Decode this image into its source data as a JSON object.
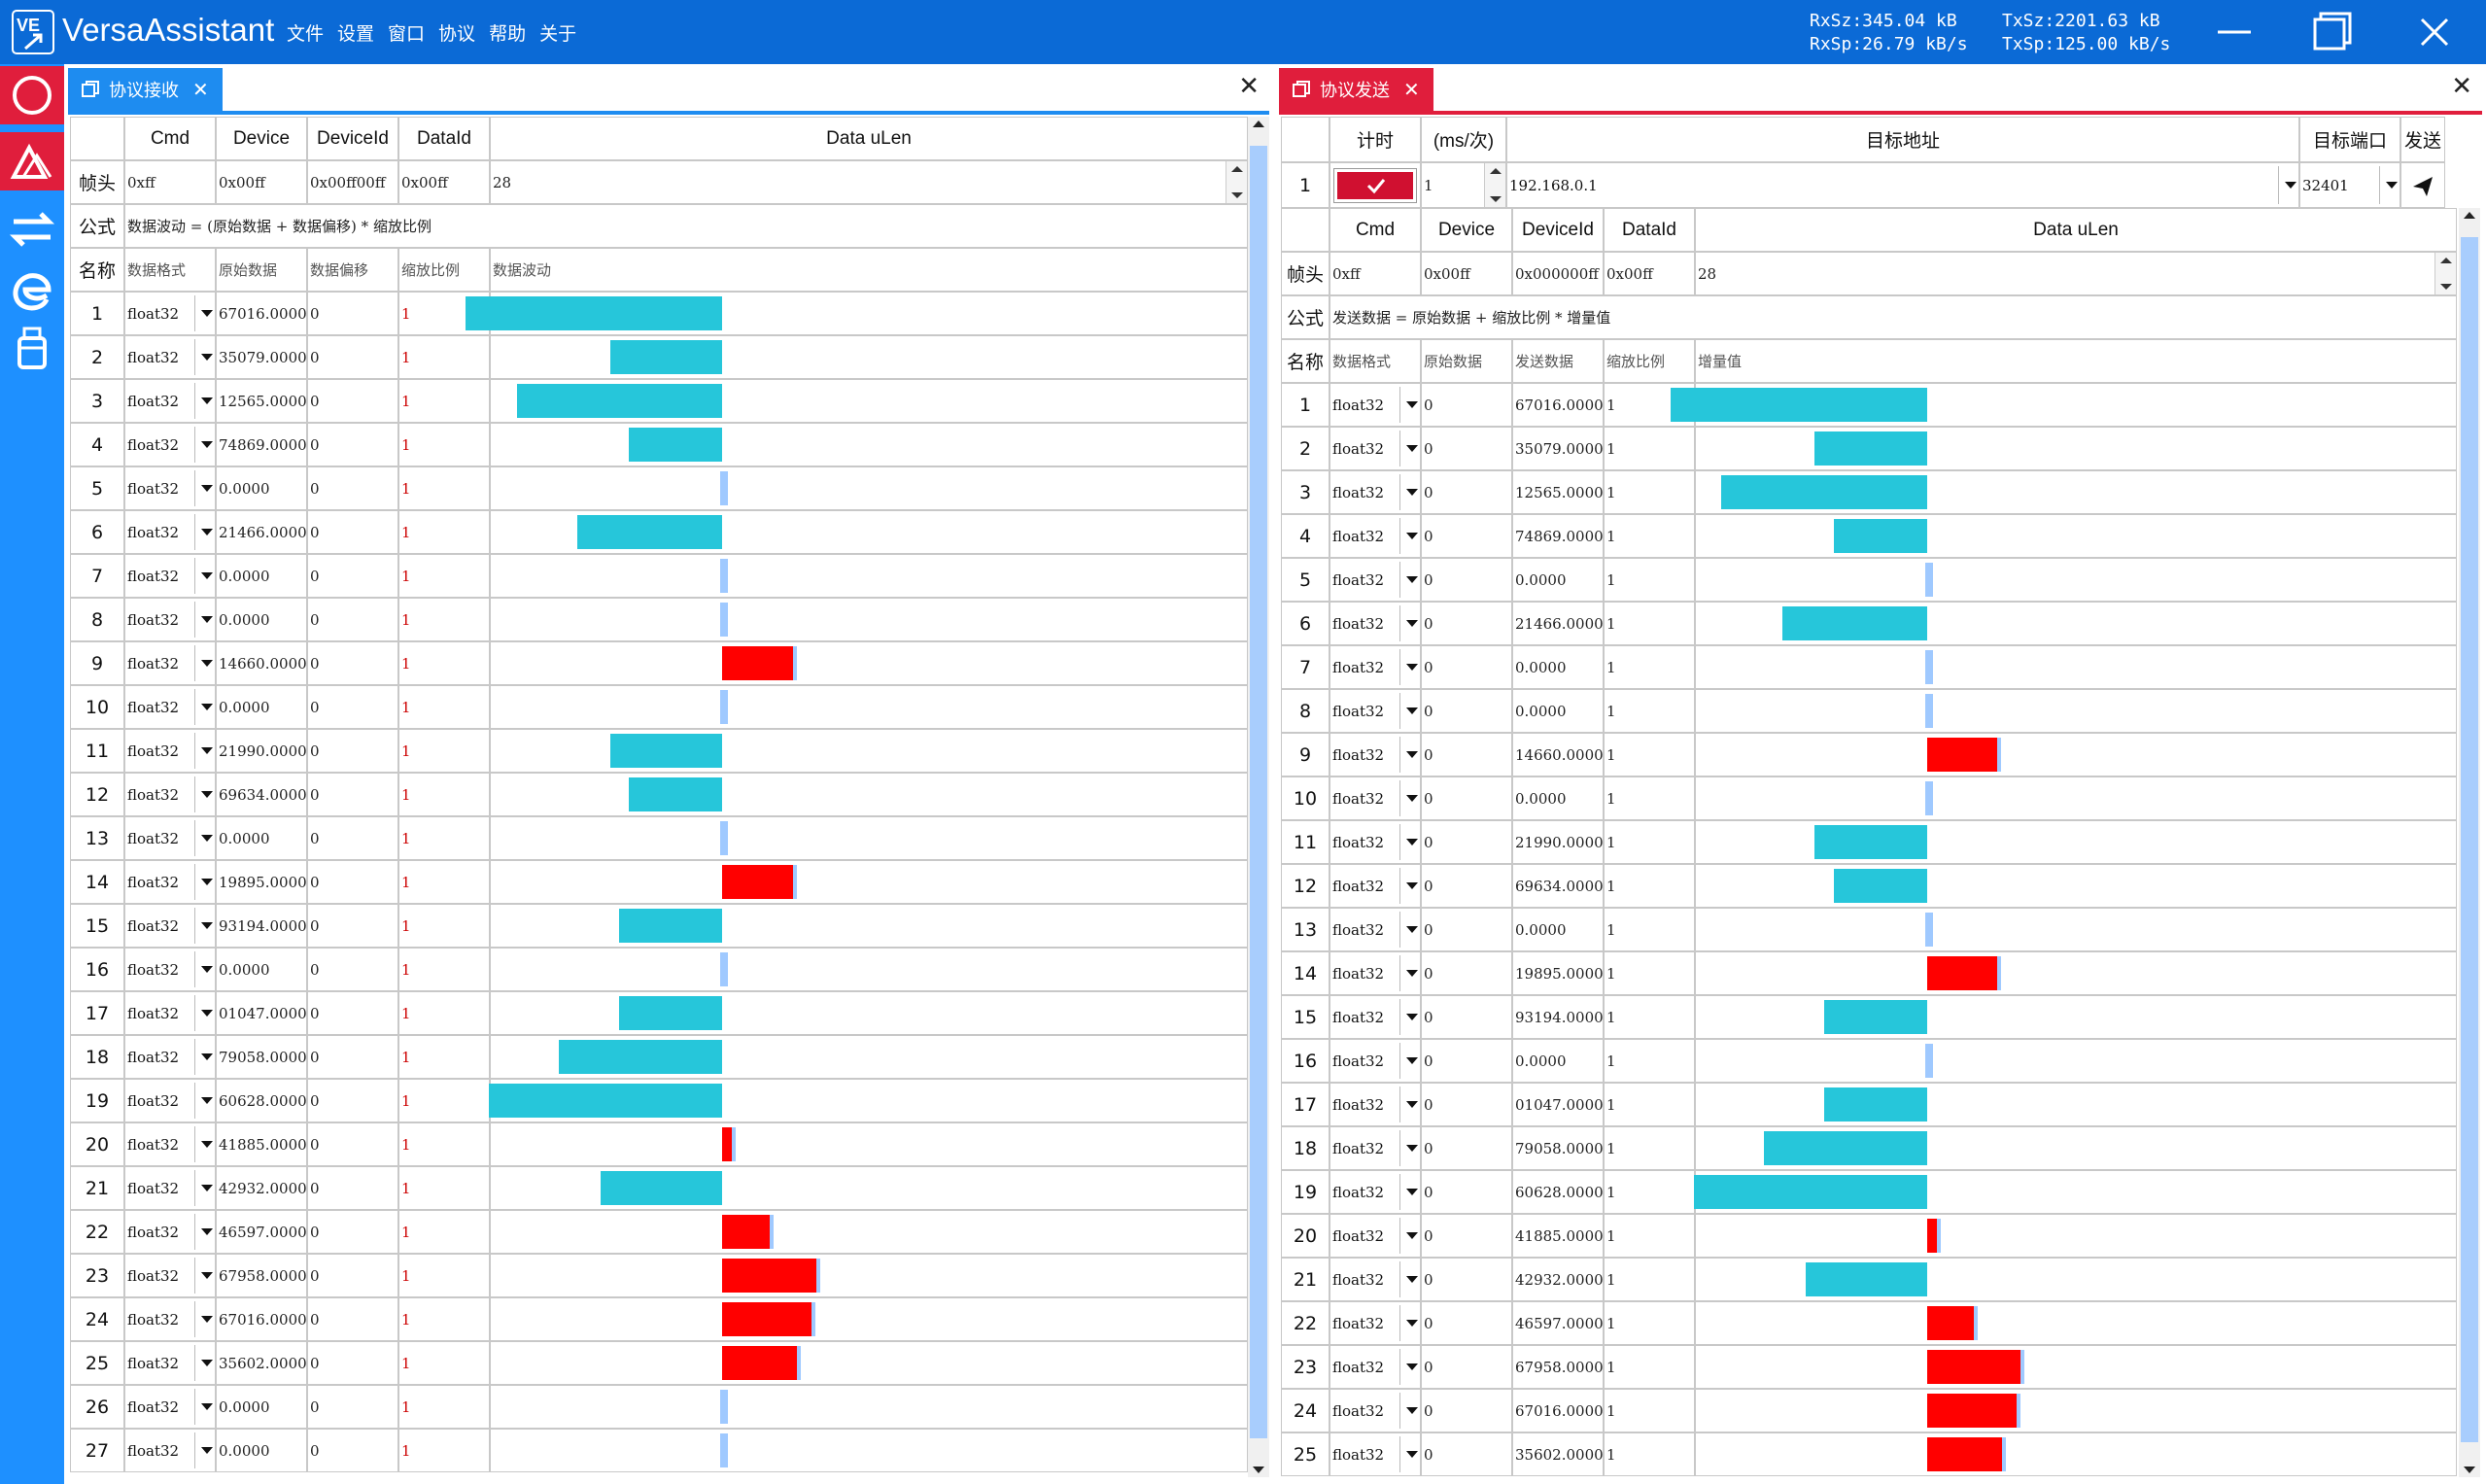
{
  "app": {
    "title": "VersaAssistant",
    "logo_text": "VE",
    "menu": [
      "文件",
      "设置",
      "窗口",
      "协议",
      "帮助",
      "关于"
    ],
    "stats": {
      "rx_size": "RxSz:345.04 kB",
      "tx_size": "TxSz:2201.63 kB",
      "rx_speed": "RxSp:26.79 kB/s",
      "tx_speed": "TxSp:125.00 kB/s"
    },
    "icons": {
      "minimize": "minimize-icon",
      "maximize": "maximize-icon",
      "close": "close-icon"
    }
  },
  "sidebar": {
    "items": [
      {
        "icon": "circle-icon",
        "active": true
      },
      {
        "icon": "triangle-wave-icon",
        "active": false
      },
      {
        "icon": "swap-arrows-icon",
        "active": false
      },
      {
        "icon": "edge-icon",
        "active": false
      },
      {
        "icon": "usb-drive-icon",
        "active": false
      }
    ]
  },
  "colors": {
    "titlebar": "#0b6ad6",
    "sidebar": "#1e90ff",
    "receive_tab": "#1e8cf0",
    "send_tab": "#e01e3c",
    "positive_bar": "#ff0000",
    "negative_bar": "#26c6da",
    "zero_bar": "#9fc9ff"
  },
  "receive": {
    "tab_label": "协议接收",
    "headers": {
      "cmd": "Cmd",
      "device": "Device",
      "deviceid": "DeviceId",
      "dataid": "DataId",
      "ulen": "Data uLen"
    },
    "frame_label": "帧头",
    "frame": {
      "cmd": "0xff",
      "device": "0x00ff",
      "deviceid": "0x00ff00ff",
      "dataid": "0x00ff",
      "ulen": "28"
    },
    "formula_label": "公式",
    "formula": "数据波动 = (原始数据 + 数据偏移) * 缩放比例",
    "name_label": "名称",
    "columns": [
      "数据格式",
      "原始数据",
      "数据偏移",
      "缩放比例",
      "数据波动"
    ],
    "rows": [
      {
        "idx": "1",
        "fmt": "float32",
        "raw": "67016.0000",
        "off": "0",
        "scale": "1",
        "wave": -0.55
      },
      {
        "idx": "2",
        "fmt": "float32",
        "raw": "35079.0000",
        "off": "0",
        "scale": "1",
        "wave": -0.24
      },
      {
        "idx": "3",
        "fmt": "float32",
        "raw": "12565.0000",
        "off": "0",
        "scale": "1",
        "wave": -0.44
      },
      {
        "idx": "4",
        "fmt": "float32",
        "raw": "74869.0000",
        "off": "0",
        "scale": "1",
        "wave": -0.2
      },
      {
        "idx": "5",
        "fmt": "float32",
        "raw": "0.0000",
        "off": "0",
        "scale": "1",
        "wave": 0
      },
      {
        "idx": "6",
        "fmt": "float32",
        "raw": "21466.0000",
        "off": "0",
        "scale": "1",
        "wave": -0.31
      },
      {
        "idx": "7",
        "fmt": "float32",
        "raw": "0.0000",
        "off": "0",
        "scale": "1",
        "wave": 0
      },
      {
        "idx": "8",
        "fmt": "float32",
        "raw": "0.0000",
        "off": "0",
        "scale": "1",
        "wave": 0
      },
      {
        "idx": "9",
        "fmt": "float32",
        "raw": "14660.0000",
        "off": "0",
        "scale": "1",
        "wave": 0.16
      },
      {
        "idx": "10",
        "fmt": "float32",
        "raw": "0.0000",
        "off": "0",
        "scale": "1",
        "wave": 0
      },
      {
        "idx": "11",
        "fmt": "float32",
        "raw": "21990.0000",
        "off": "0",
        "scale": "1",
        "wave": -0.24
      },
      {
        "idx": "12",
        "fmt": "float32",
        "raw": "69634.0000",
        "off": "0",
        "scale": "1",
        "wave": -0.2
      },
      {
        "idx": "13",
        "fmt": "float32",
        "raw": "0.0000",
        "off": "0",
        "scale": "1",
        "wave": 0
      },
      {
        "idx": "14",
        "fmt": "float32",
        "raw": "19895.0000",
        "off": "0",
        "scale": "1",
        "wave": 0.16
      },
      {
        "idx": "15",
        "fmt": "float32",
        "raw": "93194.0000",
        "off": "0",
        "scale": "1",
        "wave": -0.22
      },
      {
        "idx": "16",
        "fmt": "float32",
        "raw": "0.0000",
        "off": "0",
        "scale": "1",
        "wave": 0
      },
      {
        "idx": "17",
        "fmt": "float32",
        "raw": "01047.0000",
        "off": "0",
        "scale": "1",
        "wave": -0.22
      },
      {
        "idx": "18",
        "fmt": "float32",
        "raw": "79058.0000",
        "off": "0",
        "scale": "1",
        "wave": -0.35
      },
      {
        "idx": "19",
        "fmt": "float32",
        "raw": "60628.0000",
        "off": "0",
        "scale": "1",
        "wave": -0.5
      },
      {
        "idx": "20",
        "fmt": "float32",
        "raw": "41885.0000",
        "off": "0",
        "scale": "1",
        "wave": 0.03
      },
      {
        "idx": "21",
        "fmt": "float32",
        "raw": "42932.0000",
        "off": "0",
        "scale": "1",
        "wave": -0.26
      },
      {
        "idx": "22",
        "fmt": "float32",
        "raw": "46597.0000",
        "off": "0",
        "scale": "1",
        "wave": 0.11
      },
      {
        "idx": "23",
        "fmt": "float32",
        "raw": "67958.0000",
        "off": "0",
        "scale": "1",
        "wave": 0.21
      },
      {
        "idx": "24",
        "fmt": "float32",
        "raw": "67016.0000",
        "off": "0",
        "scale": "1",
        "wave": 0.2
      },
      {
        "idx": "25",
        "fmt": "float32",
        "raw": "35602.0000",
        "off": "0",
        "scale": "1",
        "wave": 0.17
      },
      {
        "idx": "26",
        "fmt": "float32",
        "raw": "0.0000",
        "off": "0",
        "scale": "1",
        "wave": 0
      },
      {
        "idx": "27",
        "fmt": "float32",
        "raw": "0.0000",
        "off": "0",
        "scale": "1",
        "wave": 0
      }
    ]
  },
  "send": {
    "tab_label": "协议发送",
    "top_headers": {
      "timer": "计时",
      "interval": "(ms/次)",
      "target_addr": "目标地址",
      "target_port": "目标端口",
      "send": "发送"
    },
    "top_row": {
      "idx": "1",
      "interval": "1",
      "target_addr": "192.168.0.1",
      "target_port": "32401"
    },
    "headers": {
      "cmd": "Cmd",
      "device": "Device",
      "deviceid": "DeviceId",
      "dataid": "DataId",
      "ulen": "Data uLen"
    },
    "frame_label": "帧头",
    "frame": {
      "cmd": "0xff",
      "device": "0x00ff",
      "deviceid": "0x000000ff",
      "dataid": "0x00ff",
      "ulen": "28"
    },
    "formula_label": "公式",
    "formula": "发送数据 = 原始数据 + 缩放比例 * 增量值",
    "name_label": "名称",
    "columns": [
      "数据格式",
      "原始数据",
      "发送数据",
      "缩放比例",
      "增量值"
    ],
    "rows": [
      {
        "idx": "1",
        "fmt": "float32",
        "raw": "0",
        "sent": "67016.0000",
        "scale": "1",
        "wave": -0.55
      },
      {
        "idx": "2",
        "fmt": "float32",
        "raw": "0",
        "sent": "35079.0000",
        "scale": "1",
        "wave": -0.24
      },
      {
        "idx": "3",
        "fmt": "float32",
        "raw": "0",
        "sent": "12565.0000",
        "scale": "1",
        "wave": -0.44
      },
      {
        "idx": "4",
        "fmt": "float32",
        "raw": "0",
        "sent": "74869.0000",
        "scale": "1",
        "wave": -0.2
      },
      {
        "idx": "5",
        "fmt": "float32",
        "raw": "0",
        "sent": "0.0000",
        "scale": "1",
        "wave": 0
      },
      {
        "idx": "6",
        "fmt": "float32",
        "raw": "0",
        "sent": "21466.0000",
        "scale": "1",
        "wave": -0.31
      },
      {
        "idx": "7",
        "fmt": "float32",
        "raw": "0",
        "sent": "0.0000",
        "scale": "1",
        "wave": 0
      },
      {
        "idx": "8",
        "fmt": "float32",
        "raw": "0",
        "sent": "0.0000",
        "scale": "1",
        "wave": 0
      },
      {
        "idx": "9",
        "fmt": "float32",
        "raw": "0",
        "sent": "14660.0000",
        "scale": "1",
        "wave": 0.16
      },
      {
        "idx": "10",
        "fmt": "float32",
        "raw": "0",
        "sent": "0.0000",
        "scale": "1",
        "wave": 0
      },
      {
        "idx": "11",
        "fmt": "float32",
        "raw": "0",
        "sent": "21990.0000",
        "scale": "1",
        "wave": -0.24
      },
      {
        "idx": "12",
        "fmt": "float32",
        "raw": "0",
        "sent": "69634.0000",
        "scale": "1",
        "wave": -0.2
      },
      {
        "idx": "13",
        "fmt": "float32",
        "raw": "0",
        "sent": "0.0000",
        "scale": "1",
        "wave": 0
      },
      {
        "idx": "14",
        "fmt": "float32",
        "raw": "0",
        "sent": "19895.0000",
        "scale": "1",
        "wave": 0.16
      },
      {
        "idx": "15",
        "fmt": "float32",
        "raw": "0",
        "sent": "93194.0000",
        "scale": "1",
        "wave": -0.22
      },
      {
        "idx": "16",
        "fmt": "float32",
        "raw": "0",
        "sent": "0.0000",
        "scale": "1",
        "wave": 0
      },
      {
        "idx": "17",
        "fmt": "float32",
        "raw": "0",
        "sent": "01047.0000",
        "scale": "1",
        "wave": -0.22
      },
      {
        "idx": "18",
        "fmt": "float32",
        "raw": "0",
        "sent": "79058.0000",
        "scale": "1",
        "wave": -0.35
      },
      {
        "idx": "19",
        "fmt": "float32",
        "raw": "0",
        "sent": "60628.0000",
        "scale": "1",
        "wave": -0.5
      },
      {
        "idx": "20",
        "fmt": "float32",
        "raw": "0",
        "sent": "41885.0000",
        "scale": "1",
        "wave": 0.03
      },
      {
        "idx": "21",
        "fmt": "float32",
        "raw": "0",
        "sent": "42932.0000",
        "scale": "1",
        "wave": -0.26
      },
      {
        "idx": "22",
        "fmt": "float32",
        "raw": "0",
        "sent": "46597.0000",
        "scale": "1",
        "wave": 0.11
      },
      {
        "idx": "23",
        "fmt": "float32",
        "raw": "0",
        "sent": "67958.0000",
        "scale": "1",
        "wave": 0.21
      },
      {
        "idx": "24",
        "fmt": "float32",
        "raw": "0",
        "sent": "67016.0000",
        "scale": "1",
        "wave": 0.2
      },
      {
        "idx": "25",
        "fmt": "float32",
        "raw": "0",
        "sent": "35602.0000",
        "scale": "1",
        "wave": 0.17
      }
    ]
  }
}
